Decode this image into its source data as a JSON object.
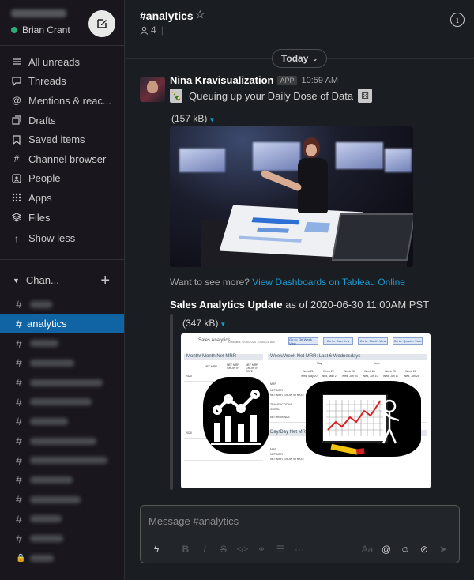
{
  "workspace": {
    "user_name": "Brian Crant"
  },
  "nav": {
    "items": [
      {
        "label": "All unreads",
        "icon": "all-unreads-icon"
      },
      {
        "label": "Threads",
        "icon": "threads-icon"
      },
      {
        "label": "Mentions & reac...",
        "icon": "mentions-icon"
      },
      {
        "label": "Drafts",
        "icon": "drafts-icon"
      },
      {
        "label": "Saved items",
        "icon": "bookmark-icon"
      },
      {
        "label": "Channel browser",
        "icon": "channel-browser-icon"
      },
      {
        "label": "People",
        "icon": "people-icon"
      },
      {
        "label": "Apps",
        "icon": "apps-icon"
      },
      {
        "label": "Files",
        "icon": "files-icon"
      }
    ],
    "show_less": "Show less"
  },
  "channels": {
    "header": "Chan...",
    "hash": "#",
    "active": "analytics"
  },
  "channel_header": {
    "title": "#analytics",
    "member_count": "4",
    "divider": "|"
  },
  "day_divider": "Today",
  "message": {
    "sender": "Nina Kravisualization",
    "badge": "APP",
    "time": "10:59 AM",
    "text": "Queuing up your Daily Dose of Data",
    "attachment1_size": "(157 kB)",
    "more_prefix": "Want to see more? ",
    "more_link": "View Dashboards on Tableau Online",
    "update_title": "Sales Analytics Update",
    "update_rest": " as of 2020-06-30 11:00AM PST",
    "attachment2_size": "(347 kB)"
  },
  "dashboard": {
    "title": "Sales Analytics",
    "updated": "Updated: 6/30/2020 10:40:26 AM",
    "buttons": [
      "Go to: Qtr Week View",
      "Go to: Overview",
      "Go to: Month View",
      "Go to: Quarter View"
    ],
    "panel_month": "Month/ Month Net MRR",
    "panel_week": "Week/Week Net MRR: Last 6 Wednesdays",
    "panel_day": "Day/Day Net MRR: Last",
    "col_net_mrr": "NET MRR",
    "col_net_mrr_growth": "NET MRR GROWTH",
    "col_net_mrr_growth_rate": "NET MRR GROWTH RATE",
    "year": "2020",
    "month_may": "May",
    "month_june": "June",
    "weeks": [
      "Week 21",
      "Week 22",
      "Week 23",
      "Week 24",
      "Week 25",
      "Week 26"
    ],
    "dates": [
      "Wed, May 20",
      "Wed, May 27",
      "Wed, Jun 03",
      "Wed, Jun 10",
      "Wed, Jun 17",
      "Wed, Jun 24"
    ],
    "row_labels": [
      "MRR",
      "NET MRR",
      "NET MRR GROWTH RATE",
      "TRANSACTIONAL",
      "CURRL",
      "NET REVENUE"
    ],
    "day_row_labels": [
      "MRR",
      "NET MRR",
      "NET MRR GROWTH RATE"
    ]
  },
  "composer": {
    "placeholder": "Message #analytics",
    "format_label": "Aa"
  }
}
